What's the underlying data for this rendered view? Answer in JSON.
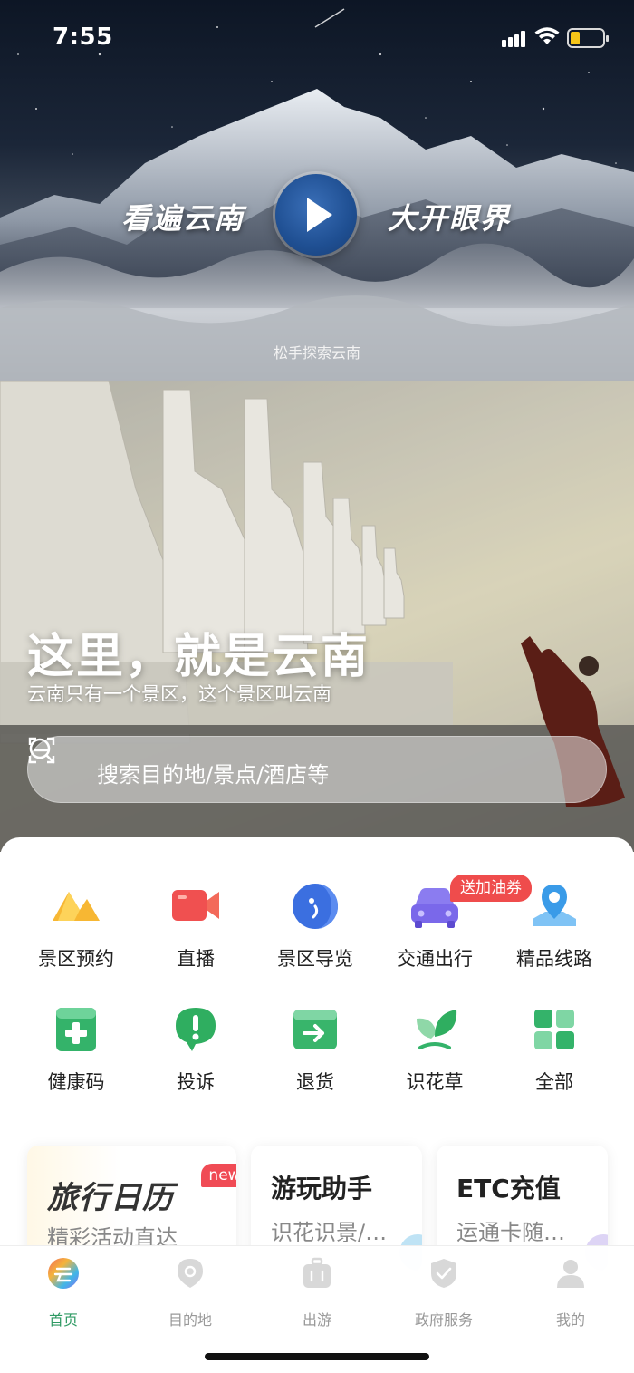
{
  "status": {
    "time": "7:55",
    "battery_color": "#f5c518"
  },
  "hero": {
    "left_text": "看遍云南",
    "right_text": "大开眼界",
    "hint": "松手探索云南",
    "play_icon": "play-icon"
  },
  "banner": {
    "title": "这里，就是云南",
    "subtitle": "云南只有一个景区，这个景区叫云南"
  },
  "search": {
    "placeholder": "搜索目的地/景点/酒店等"
  },
  "services": [
    {
      "label": "景区预约",
      "icon": "mountain-ticket-icon"
    },
    {
      "label": "直播",
      "icon": "video-camera-icon"
    },
    {
      "label": "景区导览",
      "icon": "guide-icon"
    },
    {
      "label": "交通出行",
      "icon": "car-icon"
    },
    {
      "label": "精品线路",
      "icon": "map-pin-icon"
    },
    {
      "label": "健康码",
      "icon": "health-code-icon"
    },
    {
      "label": "投诉",
      "icon": "complaint-icon"
    },
    {
      "label": "退货",
      "icon": "return-arrow-icon"
    },
    {
      "label": "识花草",
      "icon": "leaf-icon"
    },
    {
      "label": "全部",
      "icon": "all-grid-icon"
    }
  ],
  "promo_badge": "送加油券",
  "cards": {
    "calendar": {
      "title": "旅行日历",
      "badge": "new",
      "subtitle": "精彩活动直达"
    },
    "assistant": {
      "title": "游玩助手",
      "subtitle": "识花识景/…"
    },
    "etc": {
      "title": "ETC充值",
      "subtitle": "运通卡随…"
    }
  },
  "tabs": [
    {
      "label": "首页",
      "icon": "home-icon",
      "active": true
    },
    {
      "label": "目的地",
      "icon": "location-icon",
      "active": false
    },
    {
      "label": "出游",
      "icon": "luggage-icon",
      "active": false
    },
    {
      "label": "政府服务",
      "icon": "shield-icon",
      "active": false
    },
    {
      "label": "我的",
      "icon": "profile-icon",
      "active": false
    }
  ],
  "colors": {
    "accent": "#2e9a63",
    "badge_red": "#ef4c4c"
  }
}
